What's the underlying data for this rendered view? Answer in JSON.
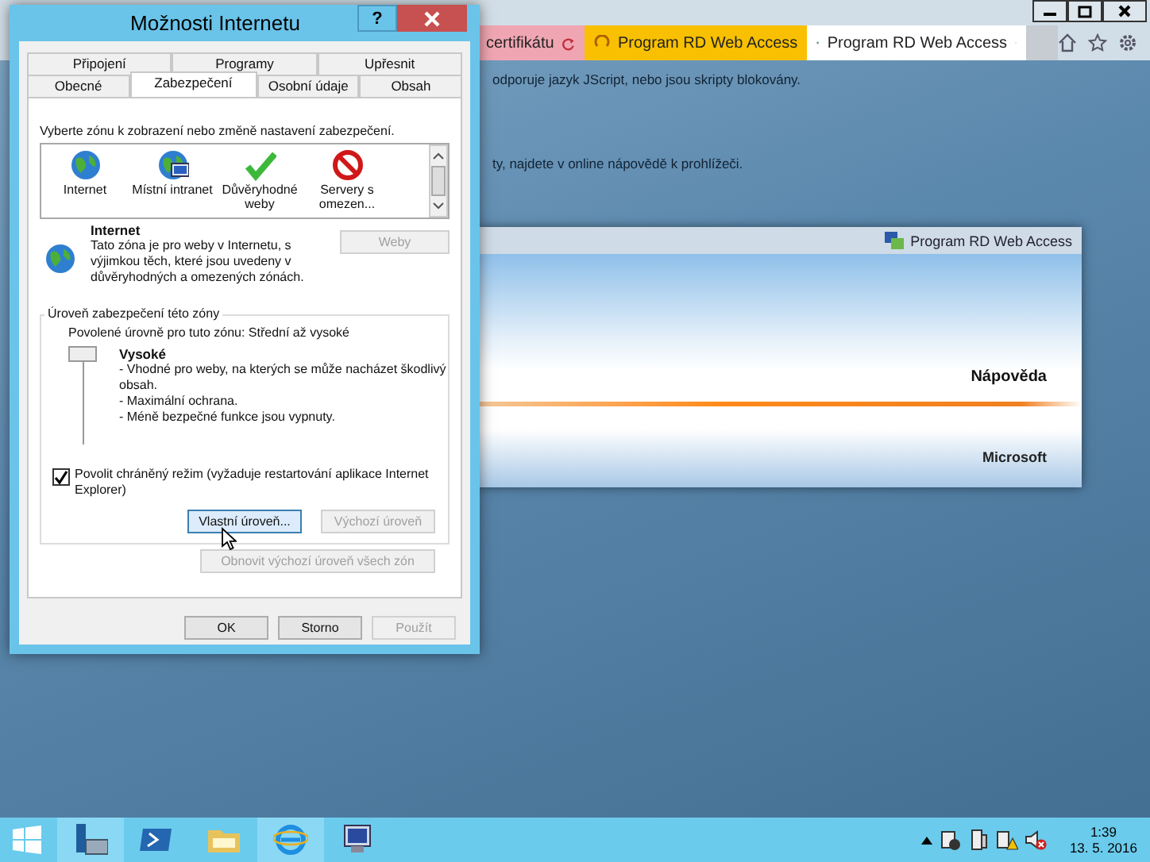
{
  "browser": {
    "tabs": [
      {
        "label": "certifikátu",
        "kind": "error",
        "selected": false
      },
      {
        "label": "Program RD Web Access",
        "kind": "loading",
        "selected": false
      },
      {
        "label": "Program RD Web Access",
        "kind": "page",
        "selected": true
      }
    ],
    "page_text": [
      "odporuje jazyk JScript, nebo jsou skripty blokovány.",
      "ty, najdete v online nápovědě k prohlížeči."
    ],
    "rd_panel": {
      "header": "Program RD Web Access",
      "help_link": "Nápověda",
      "brand": "Microsoft"
    }
  },
  "dialog": {
    "title": "Možnosti Internetu",
    "help_button": "?",
    "tab_rows": [
      [
        {
          "label": "Připojení",
          "selected": false
        },
        {
          "label": "Programy",
          "selected": false
        },
        {
          "label": "Upřesnit",
          "selected": false
        }
      ],
      [
        {
          "label": "Obecné",
          "selected": false
        },
        {
          "label": "Zabezpečení",
          "selected": true
        },
        {
          "label": "Osobní údaje",
          "selected": false
        },
        {
          "label": "Obsah",
          "selected": false
        }
      ]
    ],
    "zone_prompt": "Vyberte zónu k zobrazení nebo změně nastavení zabezpečení.",
    "zones": [
      {
        "label": "Internet",
        "kind": "globe"
      },
      {
        "label": "Místní intranet",
        "kind": "intranet"
      },
      {
        "label": "Důvěryhodné weby",
        "kind": "trusted"
      },
      {
        "label": "Servery s omezen...",
        "kind": "restricted"
      }
    ],
    "zone_info": {
      "title": "Internet",
      "description": "Tato zóna je pro weby v Internetu, s výjimkou těch, které jsou uvedeny v důvěryhodných a omezených zónách."
    },
    "sites_button": {
      "label": "Weby",
      "disabled": true
    },
    "level_group": {
      "title": "Úroveň zabezpečení této zóny",
      "allowed": "Povolené úrovně pro tuto zónu: Střední až vysoké",
      "level": 1,
      "level_name": "Vysoké",
      "bullets": [
        "- Vhodné pro weby, na kterých se může nacházet škodlivý obsah.",
        "- Maximální ochrana.",
        "- Méně bezpečné funkce jsou vypnuty."
      ],
      "protected_mode": {
        "label": "Povolit chráněný režim (vyžaduje restartování aplikace Internet Explorer)",
        "checked": true
      },
      "level_buttons": [
        {
          "label": "Vlastní úroveň...",
          "disabled": false,
          "focused": true
        },
        {
          "label": "Výchozí úroveň",
          "disabled": true,
          "focused": false
        }
      ]
    },
    "reset_button": {
      "label": "Obnovit výchozí úroveň všech zón",
      "disabled": true
    },
    "buttons": [
      {
        "label": "OK",
        "disabled": false
      },
      {
        "label": "Storno",
        "disabled": false
      },
      {
        "label": "Použít",
        "disabled": true
      }
    ]
  },
  "taskbar": {
    "time": "1:39",
    "date": "13. 5. 2016"
  }
}
